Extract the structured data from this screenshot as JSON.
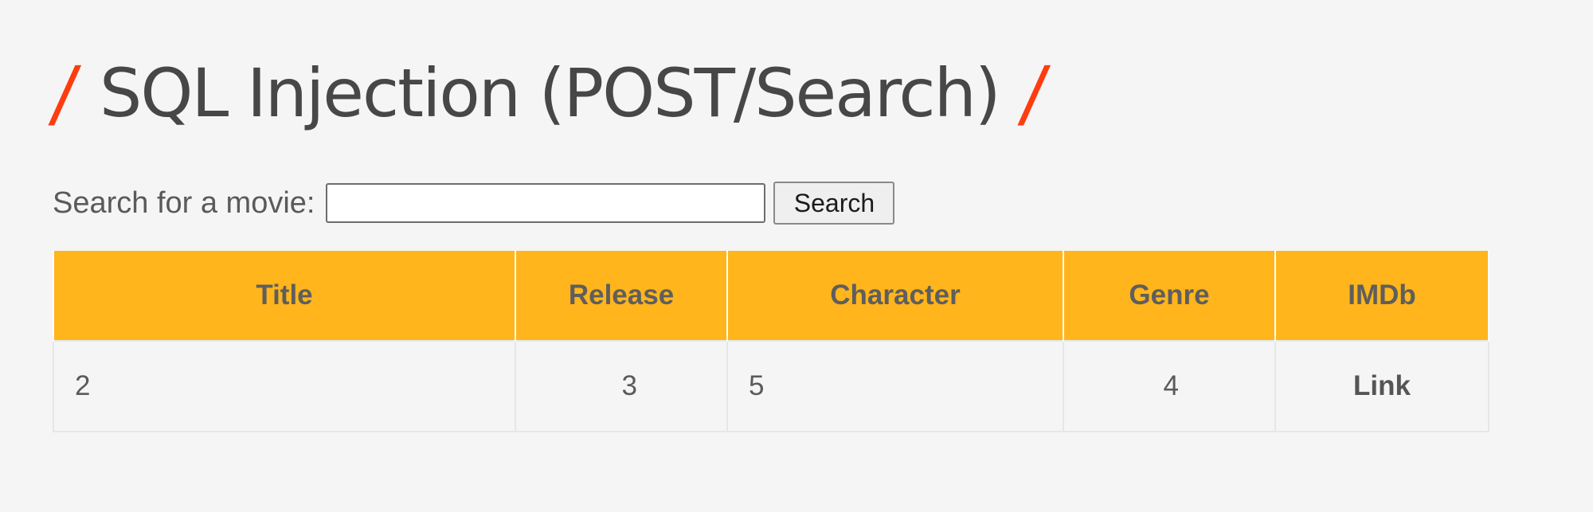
{
  "page": {
    "title": "SQL Injection (POST/Search)",
    "title_decoration": "/"
  },
  "search": {
    "label": "Search for a movie:",
    "value": "",
    "button_label": "Search"
  },
  "table": {
    "headers": [
      "Title",
      "Release",
      "Character",
      "Genre",
      "IMDb"
    ],
    "rows": [
      [
        "2",
        "3",
        "5",
        "4",
        "Link"
      ]
    ]
  },
  "colors": {
    "accent_header": "#ffb51b",
    "title_slash": "#ff3c0e",
    "background": "#f5f5f5"
  }
}
